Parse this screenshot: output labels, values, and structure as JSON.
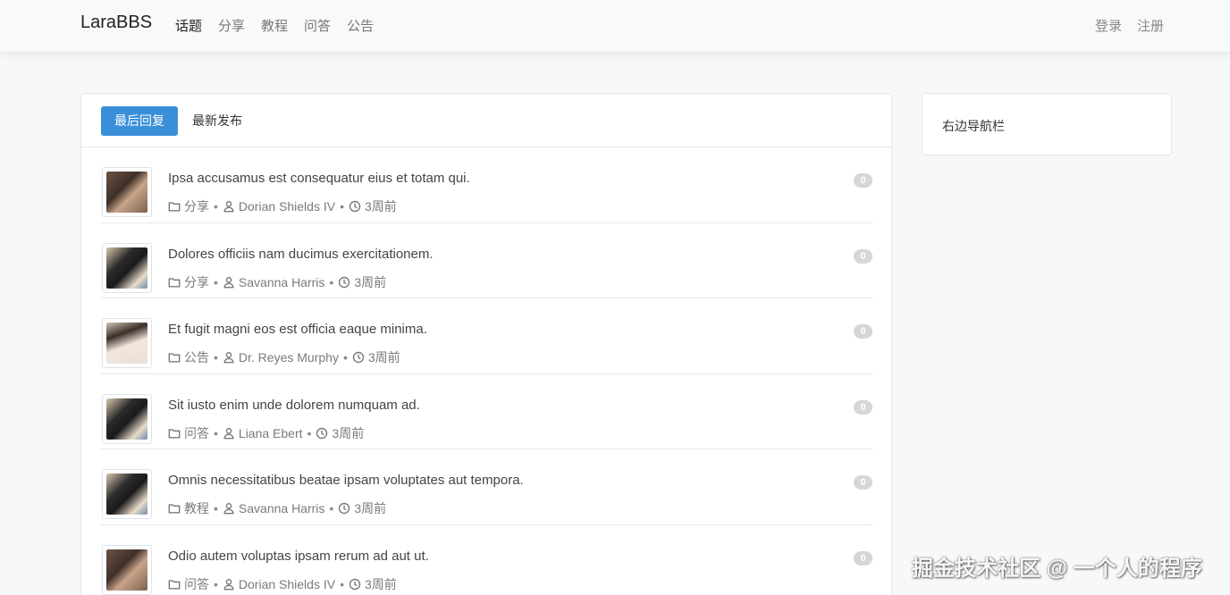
{
  "navbar": {
    "brand": "LaraBBS",
    "links": [
      "话题",
      "分享",
      "教程",
      "问答",
      "公告"
    ],
    "login": "登录",
    "register": "注册"
  },
  "tabs": {
    "latest_reply": "最后回复",
    "latest_post": "最新发布"
  },
  "topics": [
    {
      "title": "Ipsa accusamus est consequatur eius et totam qui.",
      "category": "分享",
      "author": "Dorian Shields IV",
      "time": "3周前",
      "replies": "0",
      "avatar": "av-a"
    },
    {
      "title": "Dolores officiis nam ducimus exercitationem.",
      "category": "分享",
      "author": "Savanna Harris",
      "time": "3周前",
      "replies": "0",
      "avatar": "av-b"
    },
    {
      "title": "Et fugit magni eos est officia eaque minima.",
      "category": "公告",
      "author": "Dr. Reyes Murphy",
      "time": "3周前",
      "replies": "0",
      "avatar": "av-c"
    },
    {
      "title": "Sit iusto enim unde dolorem numquam ad.",
      "category": "问答",
      "author": "Liana Ebert",
      "time": "3周前",
      "replies": "0",
      "avatar": "av-b"
    },
    {
      "title": "Omnis necessitatibus beatae ipsam voluptates aut tempora.",
      "category": "教程",
      "author": "Savanna Harris",
      "time": "3周前",
      "replies": "0",
      "avatar": "av-b"
    },
    {
      "title": "Odio autem voluptas ipsam rerum ad aut ut.",
      "category": "问答",
      "author": "Dorian Shields IV",
      "time": "3周前",
      "replies": "0",
      "avatar": "av-a"
    }
  ],
  "sidebar": {
    "title": "右边导航栏"
  },
  "watermark": "掘金技术社区 @ 一个人的程序",
  "colors": {
    "accent": "#3a8fd9",
    "page_bg": "#f6f8fa",
    "badge_bg": "#d6d6d6"
  }
}
